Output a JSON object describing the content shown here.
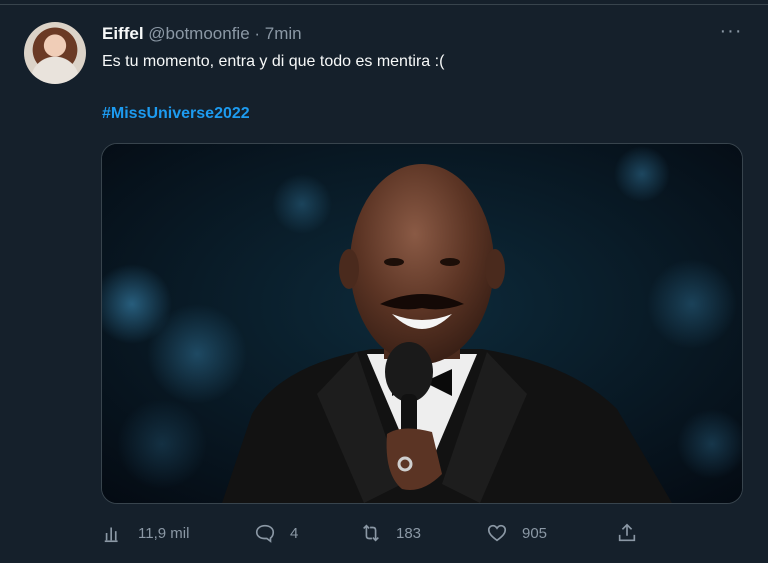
{
  "tweet": {
    "author_name": "Eiffel",
    "handle": "@botmoonfie",
    "timestamp": "· 7min",
    "text": "Es tu momento, entra y di que todo es mentira :(",
    "hashtag": "#MissUniverse2022",
    "more_label": "···"
  },
  "actions": {
    "views": "11,9 mil",
    "replies": "4",
    "retweets": "183",
    "likes": "905"
  },
  "icons": [
    "analytics-icon",
    "reply-icon",
    "retweet-icon",
    "like-icon",
    "share-icon",
    "more-icon"
  ],
  "colors": {
    "background": "#15202b",
    "link": "#1d9bf0",
    "muted": "#8b98a5"
  }
}
